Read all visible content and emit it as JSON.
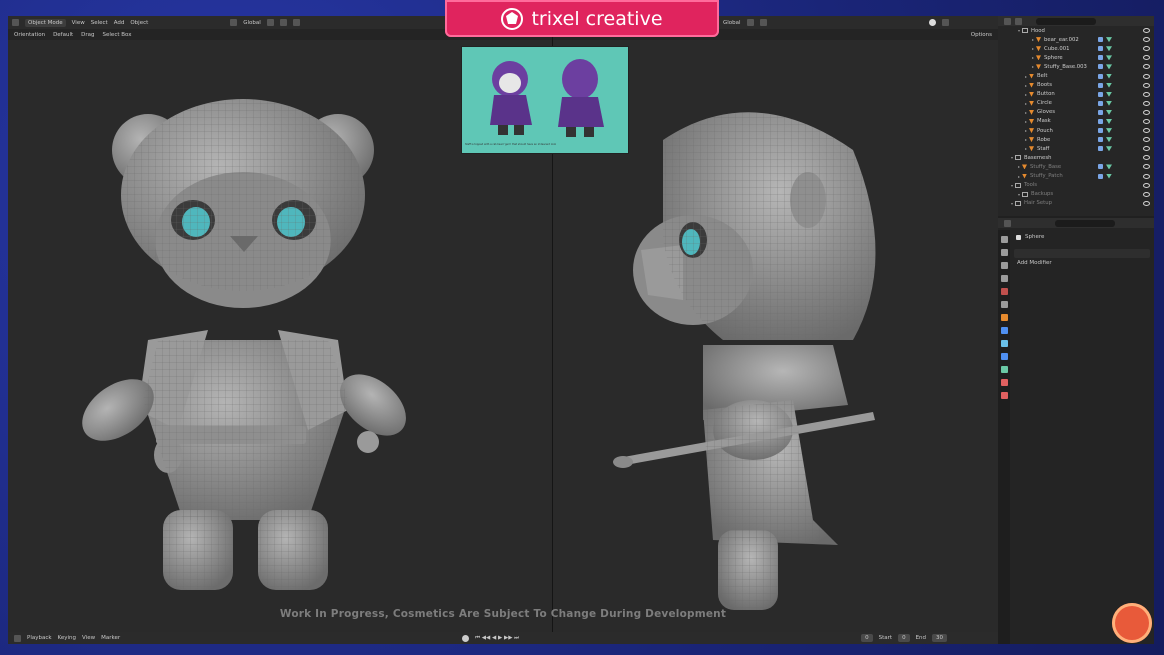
{
  "brand": {
    "logo_text": "trixel creative"
  },
  "left_header": {
    "mode": "Object Mode",
    "menus": [
      "View",
      "Select",
      "Add",
      "Object"
    ],
    "transform": "Global"
  },
  "left_subheader": {
    "orientation_label": "Orientation",
    "orientation_value": "Default",
    "drag_label": "Drag",
    "select_box": "Select Box"
  },
  "right_header": {
    "transform": "Global",
    "options_label": "Options"
  },
  "watermark": "Work In Progress, Cosmetics Are Subject To Change During Development",
  "timeline": {
    "menus": [
      "Playback",
      "Keying",
      "View",
      "Marker"
    ],
    "current_frame": "0",
    "start_label": "Start",
    "start_value": "0",
    "end_label": "End",
    "end_value": "30"
  },
  "outliner": {
    "rows": [
      {
        "label": "Hood",
        "indent": 2,
        "kind": "collection"
      },
      {
        "label": "bear_ear.002",
        "indent": 4,
        "kind": "object"
      },
      {
        "label": "Cube.001",
        "indent": 4,
        "kind": "object"
      },
      {
        "label": "Sphere",
        "indent": 4,
        "kind": "object"
      },
      {
        "label": "Stuffy_Base.003",
        "indent": 4,
        "kind": "object"
      },
      {
        "label": "Belt",
        "indent": 3,
        "kind": "object"
      },
      {
        "label": "Boots",
        "indent": 3,
        "kind": "object"
      },
      {
        "label": "Button",
        "indent": 3,
        "kind": "object"
      },
      {
        "label": "Circle",
        "indent": 3,
        "kind": "object"
      },
      {
        "label": "Gloves",
        "indent": 3,
        "kind": "object"
      },
      {
        "label": "Mask",
        "indent": 3,
        "kind": "object"
      },
      {
        "label": "Pouch",
        "indent": 3,
        "kind": "object"
      },
      {
        "label": "Robe",
        "indent": 3,
        "kind": "object"
      },
      {
        "label": "Staff",
        "indent": 3,
        "kind": "object"
      },
      {
        "label": "Basemesh",
        "indent": 1,
        "kind": "collection"
      },
      {
        "label": "Stuffy_Base",
        "indent": 2,
        "kind": "object",
        "dim": true
      },
      {
        "label": "Stuffy_Patch",
        "indent": 2,
        "kind": "object",
        "dim": true
      },
      {
        "label": "Tools",
        "indent": 1,
        "kind": "collection",
        "dim": true
      },
      {
        "label": "Backups",
        "indent": 2,
        "kind": "collection",
        "dim": true
      },
      {
        "label": "Hair Setup",
        "indent": 1,
        "kind": "collection",
        "dim": true
      }
    ]
  },
  "properties": {
    "object_name": "Sphere",
    "add_modifier": "Add Modifier",
    "tab_colors": [
      "#9a9a9a",
      "#9a9a9a",
      "#9a9a9a",
      "#9a9a9a",
      "#c0504d",
      "#9a9a9a",
      "#e58a2e",
      "#4f8ff0",
      "#6ac0e8",
      "#4f8ff0",
      "#6ac8a5",
      "#e06060",
      "#e06060"
    ]
  },
  "reference_sheet": {
    "caption": "Staff is topped with a cat-head 'gem' that should have an iridescent look"
  },
  "colors": {
    "accent_pink": "#e0245e",
    "frame_blue": "#1d2a8a"
  }
}
